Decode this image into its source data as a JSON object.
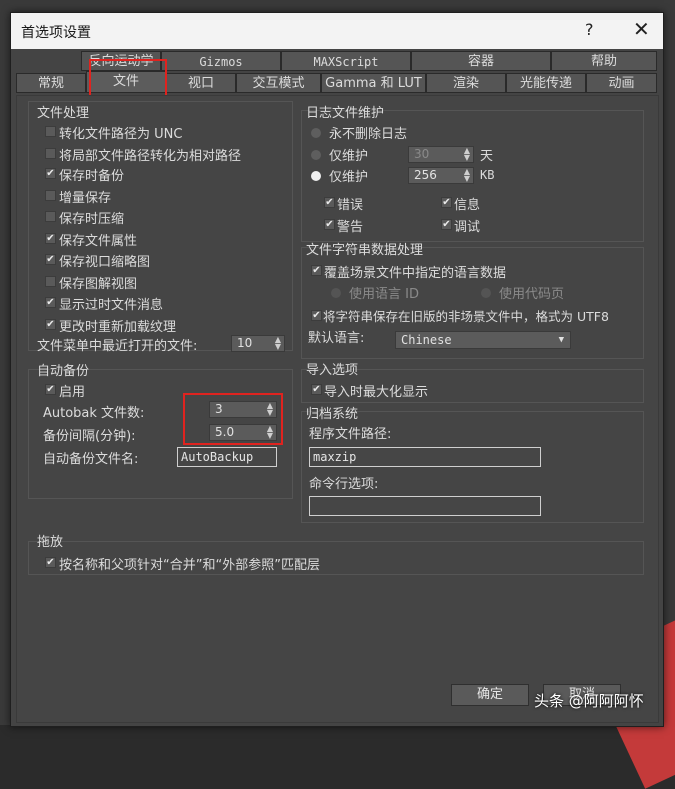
{
  "window": {
    "title": "首选项设置",
    "help": "?",
    "close": "✕"
  },
  "tabs_row1": [
    "反向运动学",
    "Gizmos",
    "MAXScript",
    "容器",
    "帮助"
  ],
  "tabs_row2": [
    "常规",
    "文件",
    "视口",
    "交互模式",
    "Gamma 和 LUT",
    "渲染",
    "光能传递",
    "动画"
  ],
  "file_handling": {
    "title": "文件处理",
    "items": [
      {
        "label": "转化文件路径为 UNC",
        "checked": false
      },
      {
        "label": "将局部文件路径转化为相对路径",
        "checked": false
      },
      {
        "label": "保存时备份",
        "checked": true
      },
      {
        "label": "增量保存",
        "checked": false
      },
      {
        "label": "保存时压缩",
        "checked": false
      },
      {
        "label": "保存文件属性",
        "checked": true
      },
      {
        "label": "保存视口缩略图",
        "checked": true
      },
      {
        "label": "保存图解视图",
        "checked": false
      },
      {
        "label": "显示过时文件消息",
        "checked": true
      },
      {
        "label": "更改时重新加载纹理",
        "checked": true
      }
    ],
    "recent_label": "文件菜单中最近打开的文件:",
    "recent_value": "10"
  },
  "log": {
    "title": "日志文件维护",
    "never_delete": "永不删除日志",
    "keep_days_label": "仅维护",
    "keep_days_value": "30",
    "days_unit": "天",
    "keep_kb_label": "仅维护",
    "keep_kb_value": "256",
    "kb_unit": "KB",
    "errors": "错误",
    "info": "信息",
    "warnings": "警告",
    "debug": "调试"
  },
  "strings": {
    "title": "文件字符串数据处理",
    "override": "覆盖场景文件中指定的语言数据",
    "use_lang_id": "使用语言 ID",
    "use_codepage": "使用代码页",
    "save_utf8": "将字符串保存在旧版的非场景文件中，格式为 UTF8",
    "default_lang_label": "默认语言:",
    "default_lang_value": "Chinese"
  },
  "autobackup": {
    "title": "自动备份",
    "enable": "启用",
    "count_label": "Autobak 文件数:",
    "count_value": "3",
    "interval_label": "备份间隔(分钟):",
    "interval_value": "5.0",
    "name_label": "自动备份文件名:",
    "name_value": "AutoBackup"
  },
  "import": {
    "title": "导入选项",
    "maximize": "导入时最大化显示"
  },
  "archive": {
    "title": "归档系统",
    "program_label": "程序文件路径:",
    "program_value": "maxzip",
    "cmdline_label": "命令行选项:",
    "cmdline_value": ""
  },
  "xref": {
    "title": "拖放",
    "match": "按名称和父项针对“合并”和“外部参照”匹配层"
  },
  "buttons": {
    "ok": "确定",
    "cancel": "取消"
  },
  "watermark": "头条 @阿阿阿怀"
}
